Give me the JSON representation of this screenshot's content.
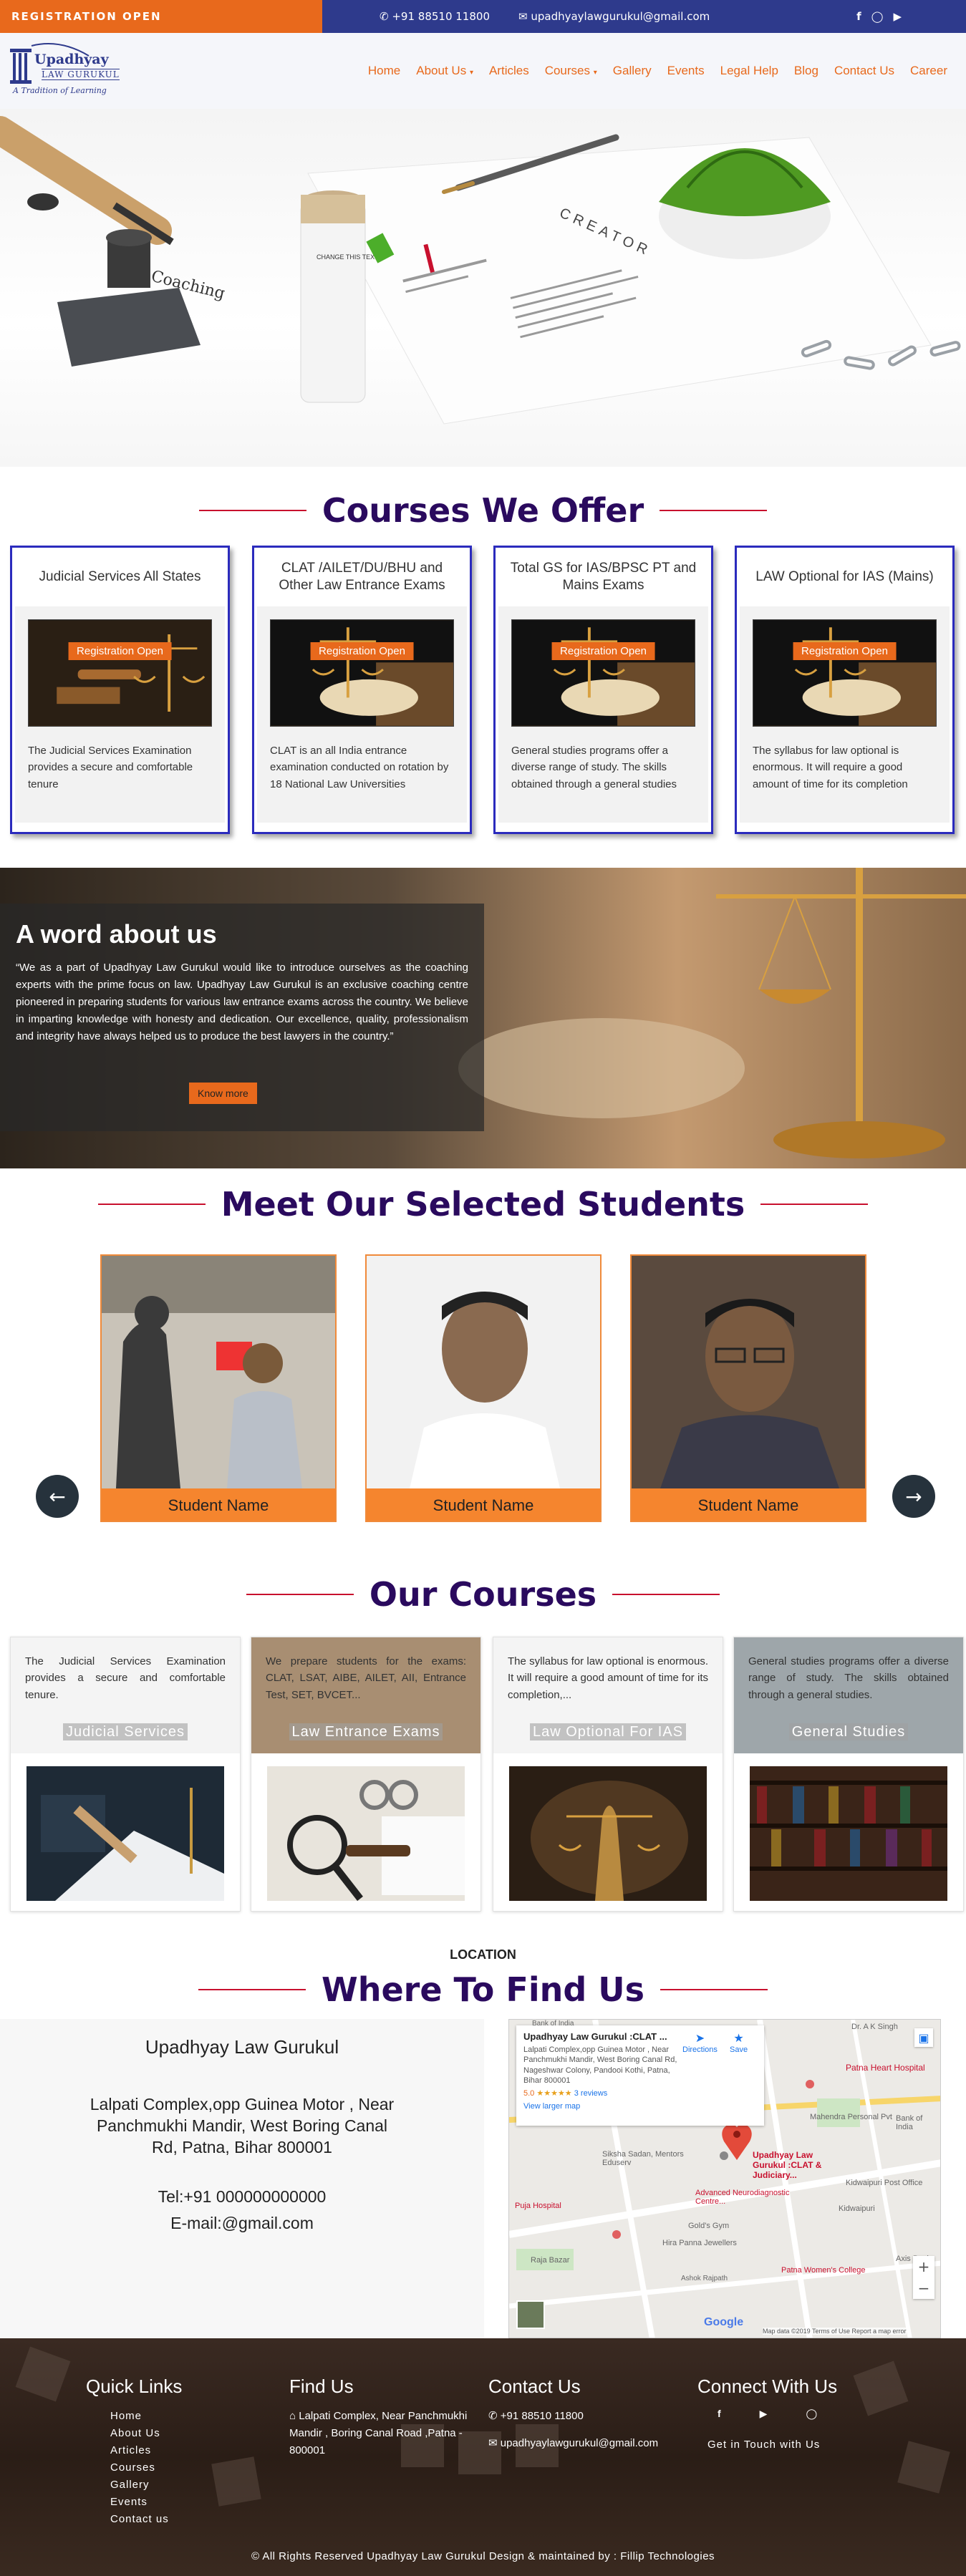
{
  "topbar": {
    "registration": "REGISTRATION OPEN",
    "phone": "+91 88510 11800",
    "email": "upadhyaylawgurukul@gmail.com",
    "social_icons": [
      "facebook-icon",
      "instagram-icon",
      "youtube-icon"
    ]
  },
  "brand": {
    "logo_line1": "Upadhyay",
    "logo_line2": "LAW GURUKUL",
    "tagline": "A Tradition of Learning"
  },
  "nav": {
    "items": [
      "Home",
      "About Us",
      "Articles",
      "Courses",
      "Gallery",
      "Events",
      "Legal Help",
      "Blog",
      "Contact Us",
      "Career"
    ],
    "dropdown_items": [
      "About Us",
      "Courses"
    ]
  },
  "hero": {
    "paper_text": "CREATOR",
    "stamp_text": "Coaching",
    "vial_text": "CHANGE THIS TEXT"
  },
  "offer": {
    "title": "Courses We Offer",
    "button": "Registration Open",
    "cards": [
      {
        "title": "Judicial Services All States",
        "text": "The Judicial Services Examination provides a secure and comfortable tenure"
      },
      {
        "title": "CLAT /AILET/DU/BHU and Other Law Entrance Exams",
        "text": "CLAT is an all India entrance examination conducted on rotation by 18 National Law Universities"
      },
      {
        "title": "Total GS for IAS/BPSC PT and Mains Exams",
        "text": "General studies programs offer a diverse range of study. The skills obtained through a general studies"
      },
      {
        "title": "LAW Optional for IAS (Mains)",
        "text": "The syllabus for law optional is enormous. It will require a good amount of time for its completion"
      }
    ]
  },
  "about": {
    "title": "A word about us",
    "text": "“We as a part of Upadhyay Law Gurukul would like to introduce ourselves as the coaching experts with the prime focus on law. Upadhyay Law Gurukul is an exclusive coaching centre pioneered in preparing students for various law entrance exams across the country. We believe in imparting knowledge with honesty and dedication. Our excellence, quality, professionalism and integrity have always helped us to produce the best lawyers in the country.”",
    "button": "Know more"
  },
  "students": {
    "title": "Meet Our Selected Students",
    "names": [
      "Student Name",
      "Student Name",
      "Student Name"
    ],
    "prev": "←",
    "next": "→"
  },
  "courses": {
    "title": "Our Courses",
    "items": [
      {
        "text": "The Judicial Services Examination provides a secure and comfortable tenure.",
        "label": "Judicial Services",
        "bg": "#f4f4f4"
      },
      {
        "text": "We prepare students for the exams: CLAT, LSAT, AIBE, AILET, AII, Entrance Test, SET, BVCET...",
        "label": "Law Entrance Exams",
        "bg": "#a88e72"
      },
      {
        "text": "The syllabus for law optional is enormous. It will require a good amount of time for its completion,...",
        "label": "Law Optional For IAS",
        "bg": "#f4f4f4"
      },
      {
        "text": "General studies programs offer a diverse range of study. The skills obtained through a general studies.",
        "label": "General Studies",
        "bg": "#9ea6aa"
      }
    ]
  },
  "location": {
    "label": "LOCATION",
    "title": "Where To Find Us",
    "name": "Upadhyay Law Gurukul",
    "address": "Lalpati Complex,opp Guinea Motor , Near Panchmukhi Mandir, West Boring Canal Rd, Patna, Bihar 800001",
    "tel": "Tel:+91 000000000000",
    "email": "E-mail:@gmail.com"
  },
  "map": {
    "card_title": "Upadhyay Law Gurukul :CLAT ...",
    "card_address": "Lalpati Complex,opp Guinea Motor , Near Panchmukhi Mandir, West Boring Canal Rd, Nageshwar Colony, Pandooi Kothi, Patna, Bihar 800001",
    "rating": "5.0",
    "reviews": "3 reviews",
    "larger": "View larger map",
    "directions": "Directions",
    "save": "Save",
    "pin_label": "Upadhyay Law Gurukul :CLAT & Judiciary...",
    "places": [
      "Bank of India",
      "Dr. A K Singh",
      "Patna Heart Hospital",
      "Mahendra Personal Pvt",
      "Siksha Sadan, Mentors Eduserv",
      "Kidwaipuri Post Office",
      "Advanced Neurodiagnostic Centre...",
      "Gold's Gym",
      "Hira Panna Jewellers",
      "Puja Hospital",
      "Patna Women's College",
      "Axis Bank",
      "Ashok Rajpath",
      "Bank of India",
      "Raja Bazar",
      "Kidwaipuri"
    ],
    "footer_text": "Map data ©2019  Terms of Use  Report a map error",
    "google": "Google"
  },
  "footer": {
    "quick_title": "Quick Links",
    "quick_links": [
      "Home",
      "About Us",
      "Articles",
      "Courses",
      "Gallery",
      "Events",
      "Contact us"
    ],
    "find_title": "Find Us",
    "find_address": "Lalpati Complex, Near Panchmukhi Mandir , Boring Canal Road ,Patna - 800001",
    "contact_title": "Contact Us",
    "contact_phone": "+91 88510 11800",
    "contact_email": "upadhyaylawgurukul@gmail.com",
    "connect_title": "Connect With Us",
    "connect_text": "Get in Touch with Us",
    "copyright": "© All Rights Reserved Upadhyay Law Gurukul Design & maintained by : Fillip Technologies"
  },
  "colors": {
    "accent": "#e8691c",
    "navy": "#2e3a8c",
    "heading": "#2a0a5e",
    "rule": "#c8102e"
  }
}
